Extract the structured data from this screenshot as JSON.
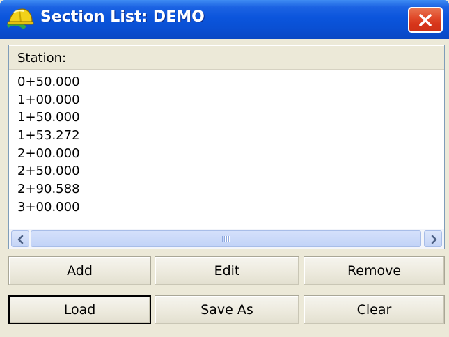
{
  "window": {
    "title": "Section List: DEMO",
    "accent_color": "#0a50d4",
    "close_color": "#d6351a"
  },
  "icons": {
    "app": "hardhat-icon",
    "close": "close-icon",
    "scroll_left": "chevron-left-icon",
    "scroll_right": "chevron-right-icon"
  },
  "list": {
    "column_header": "Station:",
    "items": [
      "0+50.000",
      "1+00.000",
      "1+50.000",
      "1+53.272",
      "2+00.000",
      "2+50.000",
      "2+90.588",
      "3+00.000"
    ]
  },
  "buttons": {
    "add": "Add",
    "edit": "Edit",
    "remove": "Remove",
    "load": "Load",
    "save_as": "Save As",
    "clear": "Clear"
  }
}
